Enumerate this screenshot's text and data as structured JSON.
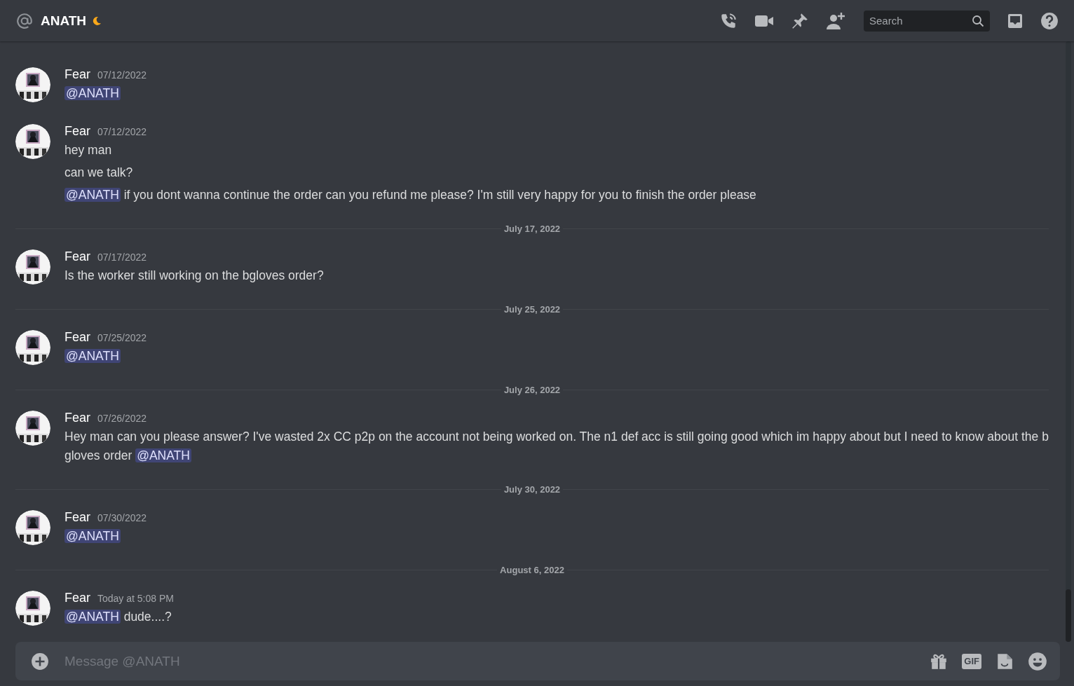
{
  "header": {
    "channel_name": "ANATH",
    "idle": true,
    "search": {
      "placeholder": "Search"
    }
  },
  "messages": [
    {
      "kind": "group",
      "author": "Fear",
      "timestamp": "07/12/2022",
      "lines": [
        [
          {
            "kind": "mention",
            "text": "@ANATH"
          }
        ]
      ]
    },
    {
      "kind": "group",
      "author": "Fear",
      "timestamp": "07/12/2022",
      "lines": [
        [
          {
            "kind": "text",
            "text": "hey man"
          }
        ],
        [
          {
            "kind": "text",
            "text": "can we talk?"
          }
        ],
        [
          {
            "kind": "mention",
            "text": "@ANATH"
          },
          {
            "kind": "text",
            "text": " if you dont wanna continue the order can you refund me please? I'm still very happy for you to finish the order please"
          }
        ]
      ]
    },
    {
      "kind": "divider",
      "text": "July 17, 2022"
    },
    {
      "kind": "group",
      "author": "Fear",
      "timestamp": "07/17/2022",
      "lines": [
        [
          {
            "kind": "text",
            "text": "Is the worker still working on the bgloves order?"
          }
        ]
      ]
    },
    {
      "kind": "divider",
      "text": "July 25, 2022"
    },
    {
      "kind": "group",
      "author": "Fear",
      "timestamp": "07/25/2022",
      "lines": [
        [
          {
            "kind": "mention",
            "text": "@ANATH"
          }
        ]
      ]
    },
    {
      "kind": "divider",
      "text": "July 26, 2022"
    },
    {
      "kind": "group",
      "author": "Fear",
      "timestamp": "07/26/2022",
      "lines": [
        [
          {
            "kind": "text",
            "text": "Hey man can you please answer? I've wasted 2x CC p2p on the account not being worked on. The n1 def acc is still going good which im happy about but I need to know about the b gloves order "
          },
          {
            "kind": "mention",
            "text": "@ANATH"
          }
        ]
      ]
    },
    {
      "kind": "divider",
      "text": "July 30, 2022"
    },
    {
      "kind": "group",
      "author": "Fear",
      "timestamp": "07/30/2022",
      "lines": [
        [
          {
            "kind": "mention",
            "text": "@ANATH"
          }
        ]
      ]
    },
    {
      "kind": "divider",
      "text": "August 6, 2022"
    },
    {
      "kind": "group",
      "author": "Fear",
      "timestamp": "Today at 5:08 PM",
      "lines": [
        [
          {
            "kind": "mention",
            "text": "@ANATH"
          },
          {
            "kind": "text",
            "text": " dude....?"
          }
        ]
      ]
    }
  ],
  "composer": {
    "placeholder": "Message @ANATH",
    "gif_label": "GIF"
  }
}
